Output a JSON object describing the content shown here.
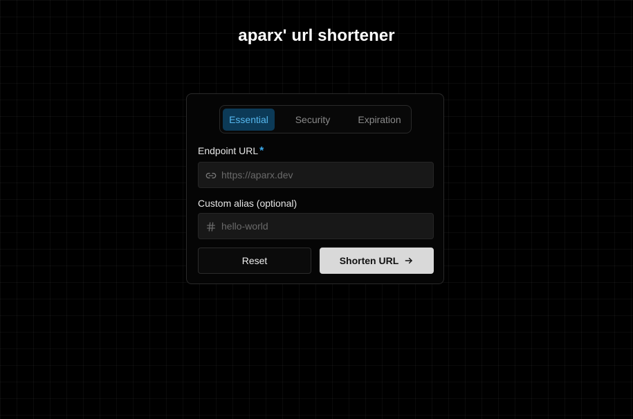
{
  "page": {
    "title": "aparx' url shortener"
  },
  "tabs": [
    {
      "label": "Essential",
      "active": true
    },
    {
      "label": "Security",
      "active": false
    },
    {
      "label": "Expiration",
      "active": false
    }
  ],
  "form": {
    "endpoint": {
      "label": "Endpoint URL",
      "required_mark": "*",
      "placeholder": "https://aparx.dev",
      "value": "",
      "icon": "link-icon"
    },
    "alias": {
      "label": "Custom alias (optional)",
      "placeholder": "hello-world",
      "value": "",
      "icon": "hash-icon"
    },
    "reset_label": "Reset",
    "submit_label": "Shorten URL",
    "submit_icon": "arrow-right-icon"
  },
  "colors": {
    "background": "#000000",
    "accent": "#56b8ef",
    "active_tab_bg": "#0c3a57",
    "primary_button_bg": "#d9d9d9"
  }
}
